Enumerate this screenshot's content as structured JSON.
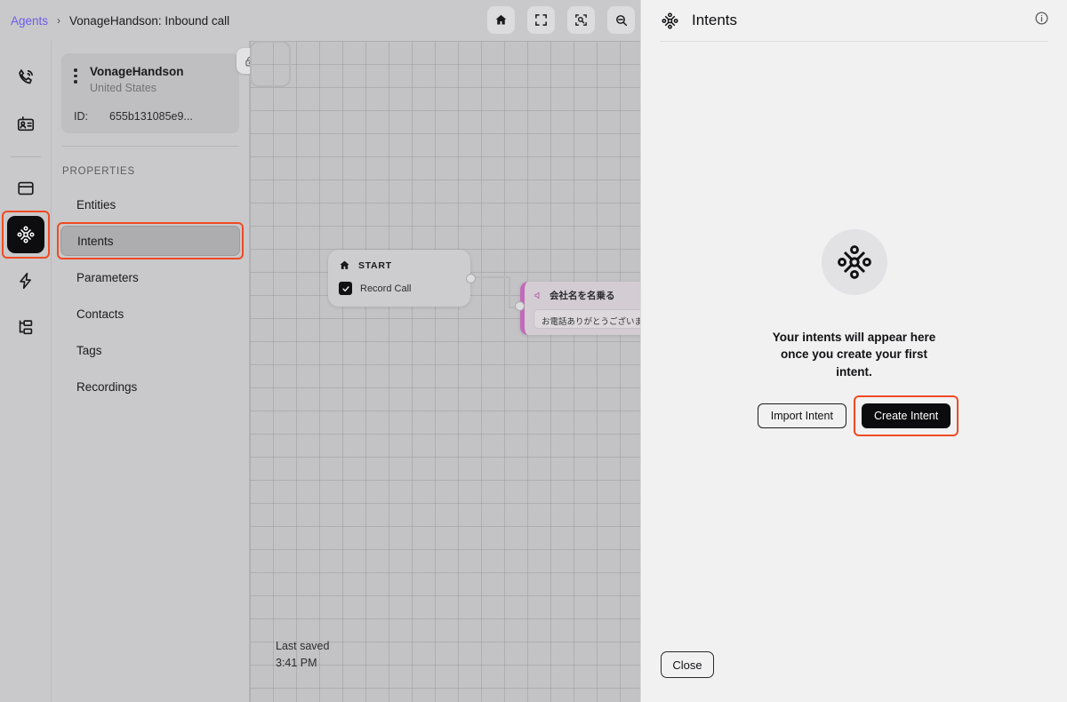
{
  "breadcrumb": {
    "root": "Agents",
    "separator": "›",
    "current": "VonageHandson: Inbound call"
  },
  "toolbar": {
    "buttons": [
      {
        "name": "home-icon",
        "label": "Home"
      },
      {
        "name": "fit-screen-icon",
        "label": "Fit to screen"
      },
      {
        "name": "zoom-to-selection-icon",
        "label": "Zoom to selection"
      },
      {
        "name": "zoom-out-icon",
        "label": "Zoom out"
      }
    ]
  },
  "rail": {
    "items": [
      {
        "icon": "phone-call-icon",
        "label": "Calls",
        "active": false
      },
      {
        "icon": "id-card-icon",
        "label": "Contacts",
        "active": false
      },
      {
        "icon": "panel-icon",
        "label": "Flows",
        "active": false
      },
      {
        "icon": "intent-node-icon",
        "label": "Intents",
        "active": true
      },
      {
        "icon": "lightning-bolt-icon",
        "label": "Events",
        "active": false
      },
      {
        "icon": "hierarchy-icon",
        "label": "Structure",
        "active": false
      }
    ]
  },
  "agent_card": {
    "name": "VonageHandson",
    "country": "United States",
    "id_label": "ID:",
    "id_value": "655b131085e9...",
    "lock_icon": "lock-icon",
    "menu_icon": "more-vertical-icon"
  },
  "properties": {
    "title": "PROPERTIES",
    "items": [
      {
        "label": "Entities",
        "selected": false
      },
      {
        "label": "Intents",
        "selected": true
      },
      {
        "label": "Parameters",
        "selected": false
      },
      {
        "label": "Contacts",
        "selected": false
      },
      {
        "label": "Tags",
        "selected": false
      },
      {
        "label": "Recordings",
        "selected": false
      }
    ]
  },
  "canvas": {
    "start_node": {
      "icon": "home-icon",
      "title": "START",
      "checkbox_icon": "check-icon",
      "checkbox_label": "Record Call",
      "checked": true
    },
    "message_node": {
      "icon": "speaker-icon",
      "title": "会社名を名乗る",
      "text": "お電話ありがとうございます。K..."
    },
    "last_saved_label": "Last saved",
    "last_saved_time": "3:41 PM"
  },
  "panel": {
    "icon": "intent-node-icon",
    "title": "Intents",
    "info_icon": "info-icon",
    "empty_state": {
      "icon": "intent-node-icon",
      "message": "Your intents will appear here once you create your first intent.",
      "import_label": "Import Intent",
      "create_label": "Create Intent"
    },
    "close_label": "Close"
  },
  "colors": {
    "accent_link": "#6c5ce9",
    "highlight": "#f04a23",
    "node_accent": "#c06bb9",
    "dark_button": "#0c0c0e"
  }
}
